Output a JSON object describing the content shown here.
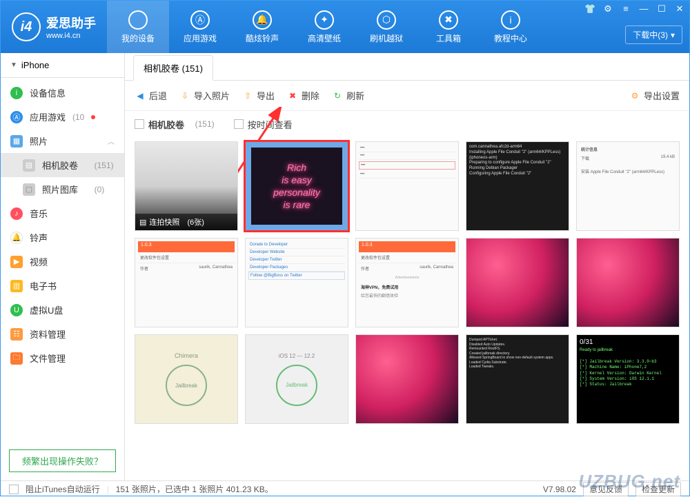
{
  "app": {
    "title": "爱思助手",
    "url": "www.i4.cn"
  },
  "nav": [
    {
      "label": "我的设备",
      "icon": ""
    },
    {
      "label": "应用游戏",
      "icon": "A"
    },
    {
      "label": "酷炫铃声",
      "icon": "🔔"
    },
    {
      "label": "高清壁纸",
      "icon": "✦"
    },
    {
      "label": "刷机越狱",
      "icon": "⬡"
    },
    {
      "label": "工具箱",
      "icon": "✖"
    },
    {
      "label": "教程中心",
      "icon": "i"
    }
  ],
  "download_btn": "下载中(3)",
  "device_name": "iPhone",
  "sidebar": {
    "items": [
      {
        "label": "设备信息",
        "color": "#2fbf4f",
        "icon": "i"
      },
      {
        "label": "应用游戏",
        "color": "#2d8ee8",
        "icon": "A",
        "count_text": "(10",
        "dot": true
      },
      {
        "label": "照片",
        "color": "#5aa7e8",
        "icon": "▦",
        "expanded": true
      },
      {
        "label": "音乐",
        "color": "#ff5060",
        "icon": "♪"
      },
      {
        "label": "铃声",
        "color": "#4aa0ea",
        "icon": "🔔"
      },
      {
        "label": "视频",
        "color": "#ffa030",
        "icon": "▶"
      },
      {
        "label": "电子书",
        "color": "#ffb820",
        "icon": "▥"
      },
      {
        "label": "虚拟U盘",
        "color": "#2fbf4f",
        "icon": "U"
      },
      {
        "label": "资料管理",
        "color": "#ff9a40",
        "icon": "☷"
      },
      {
        "label": "文件管理",
        "color": "#ff7a30",
        "icon": "🗀"
      }
    ],
    "sub_items": [
      {
        "label": "相机胶卷",
        "count": "(151)"
      },
      {
        "label": "照片图库",
        "count": "(0)"
      }
    ],
    "help": "频繁出现操作失败？"
  },
  "content_tab": "相机胶卷 (151)",
  "toolbar": {
    "back": "后退",
    "import": "导入照片",
    "export": "导出",
    "delete": "删除",
    "refresh": "刷新",
    "settings": "导出设置"
  },
  "filter": {
    "album": "相机胶卷",
    "album_count": "(151)",
    "by_time": "按时间查看"
  },
  "burst": {
    "label": "连拍快照",
    "count": "(6张)"
  },
  "neon": {
    "l1": "Rich",
    "l2": "is easy",
    "l3": "personality",
    "l4": "is rare"
  },
  "thumbs": {
    "chimera": "Chimera",
    "jailbreak": "Jailbreak",
    "ios": "iOS 12 — 12.2",
    "vpn_title": "海神VPN，免费试用",
    "vpn_sub": "给您最快的翻墙体验",
    "dev1": "Donate to Developer",
    "dev2": "Developer Website",
    "dev3": "Developer Twitter",
    "dev4": "Developer Packages",
    "dev5": "Follow @BigBoss on Twitter",
    "orange": "1.0.3",
    "row_label": "更改软件包设置",
    "author_label": "作者",
    "author": "saurik, Cannathea",
    "dark_title": "统计信息",
    "dark_dl": "下载",
    "dark_size": "19.4 kB",
    "dark_inst": "安装 Apple File Conduit \"2\" (arm64/KPPLess)",
    "term1": "0/31",
    "term2": "Ready to jailbreak"
  },
  "status": {
    "itunes": "阻止iTunes自动运行",
    "summary": "151 张照片，已选中 1 张照片 401.23 KB。",
    "version": "V7.98.02",
    "feedback": "意见反馈",
    "update": "检查更新"
  },
  "watermark": "UZBUG.net"
}
